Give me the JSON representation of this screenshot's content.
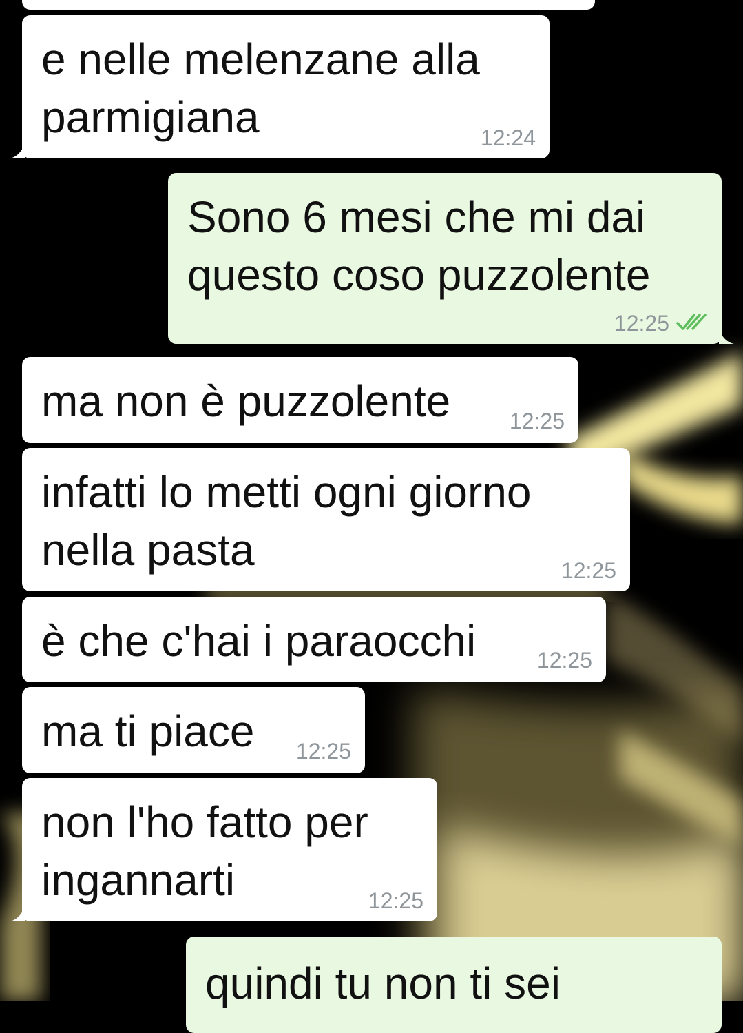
{
  "colors": {
    "incoming_bubble": "#ffffff",
    "outgoing_bubble": "#e9f8e0",
    "timestamp": "#8f969b",
    "read_ticks": "#5fbf5f",
    "background": "#000000"
  },
  "messages": [
    {
      "direction": "incoming",
      "text": "e nelle melenzane alla\nparmigiana",
      "time": "12:24"
    },
    {
      "direction": "outgoing",
      "text": "Sono 6 mesi che mi dai\nquesto coso puzzolente",
      "time": "12:25",
      "status_icon": "double-check-icon"
    },
    {
      "direction": "incoming",
      "text": "ma non è puzzolente",
      "time": "12:25"
    },
    {
      "direction": "incoming",
      "text": "infatti lo metti ogni giorno\nnella pasta",
      "time": "12:25"
    },
    {
      "direction": "incoming",
      "text": "è che c'hai i paraocchi",
      "time": "12:25"
    },
    {
      "direction": "incoming",
      "text": "ma ti piace",
      "time": "12:25"
    },
    {
      "direction": "incoming",
      "text": "non l'ho fatto per\ningannarti",
      "time": "12:25"
    },
    {
      "direction": "outgoing",
      "text": "quindi tu non ti sei",
      "time": ""
    }
  ]
}
